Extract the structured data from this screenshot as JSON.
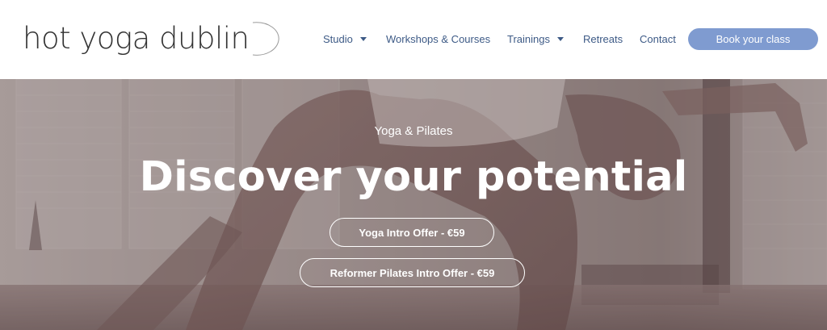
{
  "brand": {
    "logo_text": "hot yoga dublin"
  },
  "nav": {
    "items": [
      {
        "label": "Studio",
        "has_dropdown": true
      },
      {
        "label": "Workshops & Courses",
        "has_dropdown": false
      },
      {
        "label": "Trainings",
        "has_dropdown": true
      },
      {
        "label": "Retreats",
        "has_dropdown": false
      },
      {
        "label": "Contact",
        "has_dropdown": false
      }
    ],
    "cta_label": "Book your class"
  },
  "hero": {
    "subtitle": "Yoga & Pilates",
    "headline": "Discover your potential",
    "buttons": [
      {
        "label": "Yoga Intro Offer - €59"
      },
      {
        "label": "Reformer Pilates Intro Offer - €59"
      }
    ]
  },
  "colors": {
    "nav_text": "#3d5a86",
    "cta_bg": "#7f9bd0",
    "logo_text": "#333333",
    "hero_tint": "#8a7b7a"
  }
}
